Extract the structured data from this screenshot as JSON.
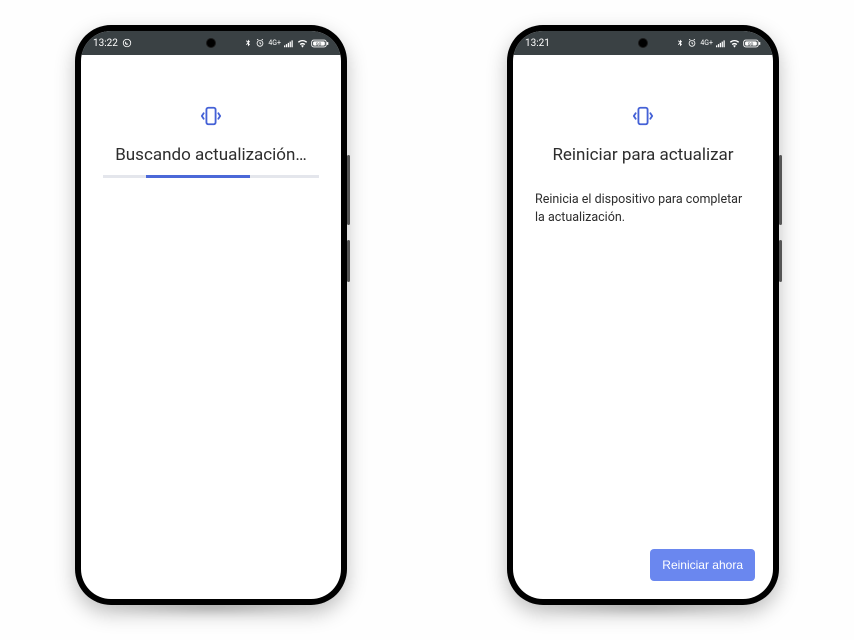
{
  "left": {
    "statusbar": {
      "time": "13:22"
    },
    "title": "Buscando actualización…"
  },
  "right": {
    "statusbar": {
      "time": "13:21"
    },
    "title": "Reiniciar para actualizar",
    "description": "Reinicia el dispositivo para completar la actualización.",
    "button_label": "Reiniciar ahora"
  },
  "icons": {
    "update": "system-update-icon",
    "whatsapp": "whatsapp-icon",
    "bluetooth": "bluetooth-icon",
    "alarm": "alarm-icon",
    "network": "4G+",
    "signal": "signal-icon",
    "wifi": "wifi-icon",
    "battery": "battery-icon"
  }
}
